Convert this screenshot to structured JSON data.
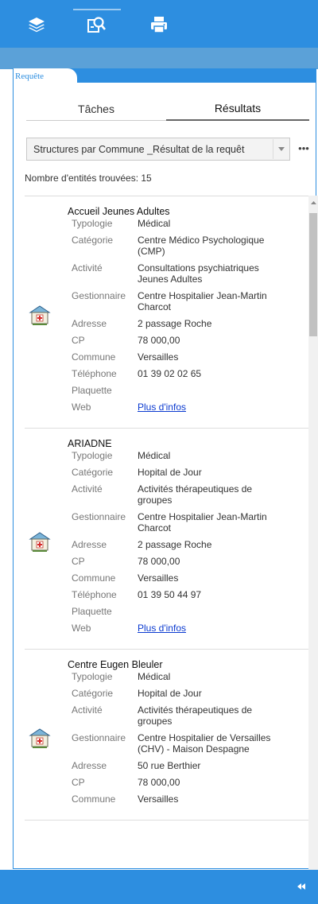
{
  "toolbar": {
    "icons": [
      "layers-icon",
      "query-icon",
      "print-icon"
    ],
    "color": "#2d8ee0"
  },
  "panel": {
    "tab_label": "Requête",
    "tabs": [
      "Tâches",
      "Résultats"
    ],
    "active_tab": "Résultats",
    "dropdown_value": "Structures par Commune _Résultat de la requêt",
    "more_label": "•••",
    "count_text": "Nombre d'entités trouvées: 15"
  },
  "records": [
    {
      "title": "Accueil Jeunes Adultes",
      "fields": [
        {
          "k": "Typologie",
          "v": "Médical"
        },
        {
          "k": "Catégorie",
          "v": "Centre Médico Psychologique (CMP)"
        },
        {
          "k": "Activité",
          "v": "Consultations psychiatriques Jeunes Adultes"
        },
        {
          "k": "Gestionnaire",
          "v": "Centre Hospitalier Jean-Martin Charcot"
        },
        {
          "k": "Adresse",
          "v": "2 passage Roche"
        },
        {
          "k": "CP",
          "v": "78 000,00"
        },
        {
          "k": "Commune",
          "v": "Versailles"
        },
        {
          "k": "Téléphone",
          "v": "01 39 02 02 65"
        },
        {
          "k": "Plaquette",
          "v": ""
        },
        {
          "k": "Web",
          "v": "Plus d'infos",
          "link": true
        }
      ]
    },
    {
      "title": "ARIADNE",
      "fields": [
        {
          "k": "Typologie",
          "v": "Médical"
        },
        {
          "k": "Catégorie",
          "v": "Hopital de Jour"
        },
        {
          "k": "Activité",
          "v": "Activités thérapeutiques de groupes"
        },
        {
          "k": "Gestionnaire",
          "v": "Centre Hospitalier Jean-Martin Charcot"
        },
        {
          "k": "Adresse",
          "v": "2 passage Roche"
        },
        {
          "k": "CP",
          "v": "78 000,00"
        },
        {
          "k": "Commune",
          "v": "Versailles"
        },
        {
          "k": "Téléphone",
          "v": "01 39 50 44 97"
        },
        {
          "k": "Plaquette",
          "v": ""
        },
        {
          "k": "Web",
          "v": "Plus d'infos",
          "link": true
        }
      ]
    },
    {
      "title": "Centre Eugen Bleuler",
      "fields": [
        {
          "k": "Typologie",
          "v": "Médical"
        },
        {
          "k": "Catégorie",
          "v": "Hopital de Jour"
        },
        {
          "k": "Activité",
          "v": "Activités thérapeutiques de groupes"
        },
        {
          "k": "Gestionnaire",
          "v": "Centre Hospitalier de Versailles (CHV) - Maison Despagne"
        },
        {
          "k": "Adresse",
          "v": "50 rue Berthier"
        },
        {
          "k": "CP",
          "v": "78 000,00"
        },
        {
          "k": "Commune",
          "v": "Versailles"
        }
      ]
    }
  ]
}
